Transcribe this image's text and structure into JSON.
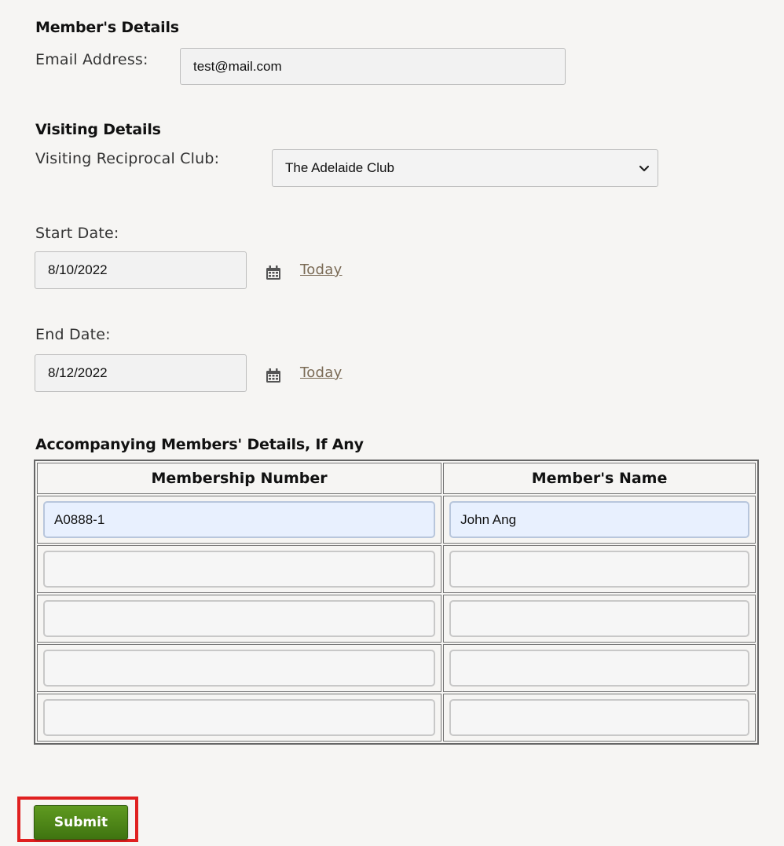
{
  "members_details": {
    "title": "Member's Details",
    "email_label": "Email Address:",
    "email_value": "test@mail.com"
  },
  "visiting_details": {
    "title": "Visiting Details",
    "club_label": "Visiting Reciprocal Club:",
    "club_value": "The Adelaide Club",
    "start_label": "Start Date:",
    "start_value": "8/10/2022",
    "end_label": "End Date:",
    "end_value": "8/12/2022",
    "today_link": "Today",
    "calendar_icon": "calendar-icon"
  },
  "accompanying": {
    "title": "Accompanying Members' Details, If Any",
    "headers": [
      "Membership Number",
      "Member's Name"
    ],
    "rows": [
      {
        "number": "A0888-1",
        "name": "John Ang"
      },
      {
        "number": "",
        "name": ""
      },
      {
        "number": "",
        "name": ""
      },
      {
        "number": "",
        "name": ""
      },
      {
        "number": "",
        "name": ""
      }
    ]
  },
  "actions": {
    "submit_label": "Submit"
  },
  "colors": {
    "submit_green": "#4f8a17",
    "highlight_red": "#e02020",
    "autofill_blue": "#e8f0fe"
  }
}
